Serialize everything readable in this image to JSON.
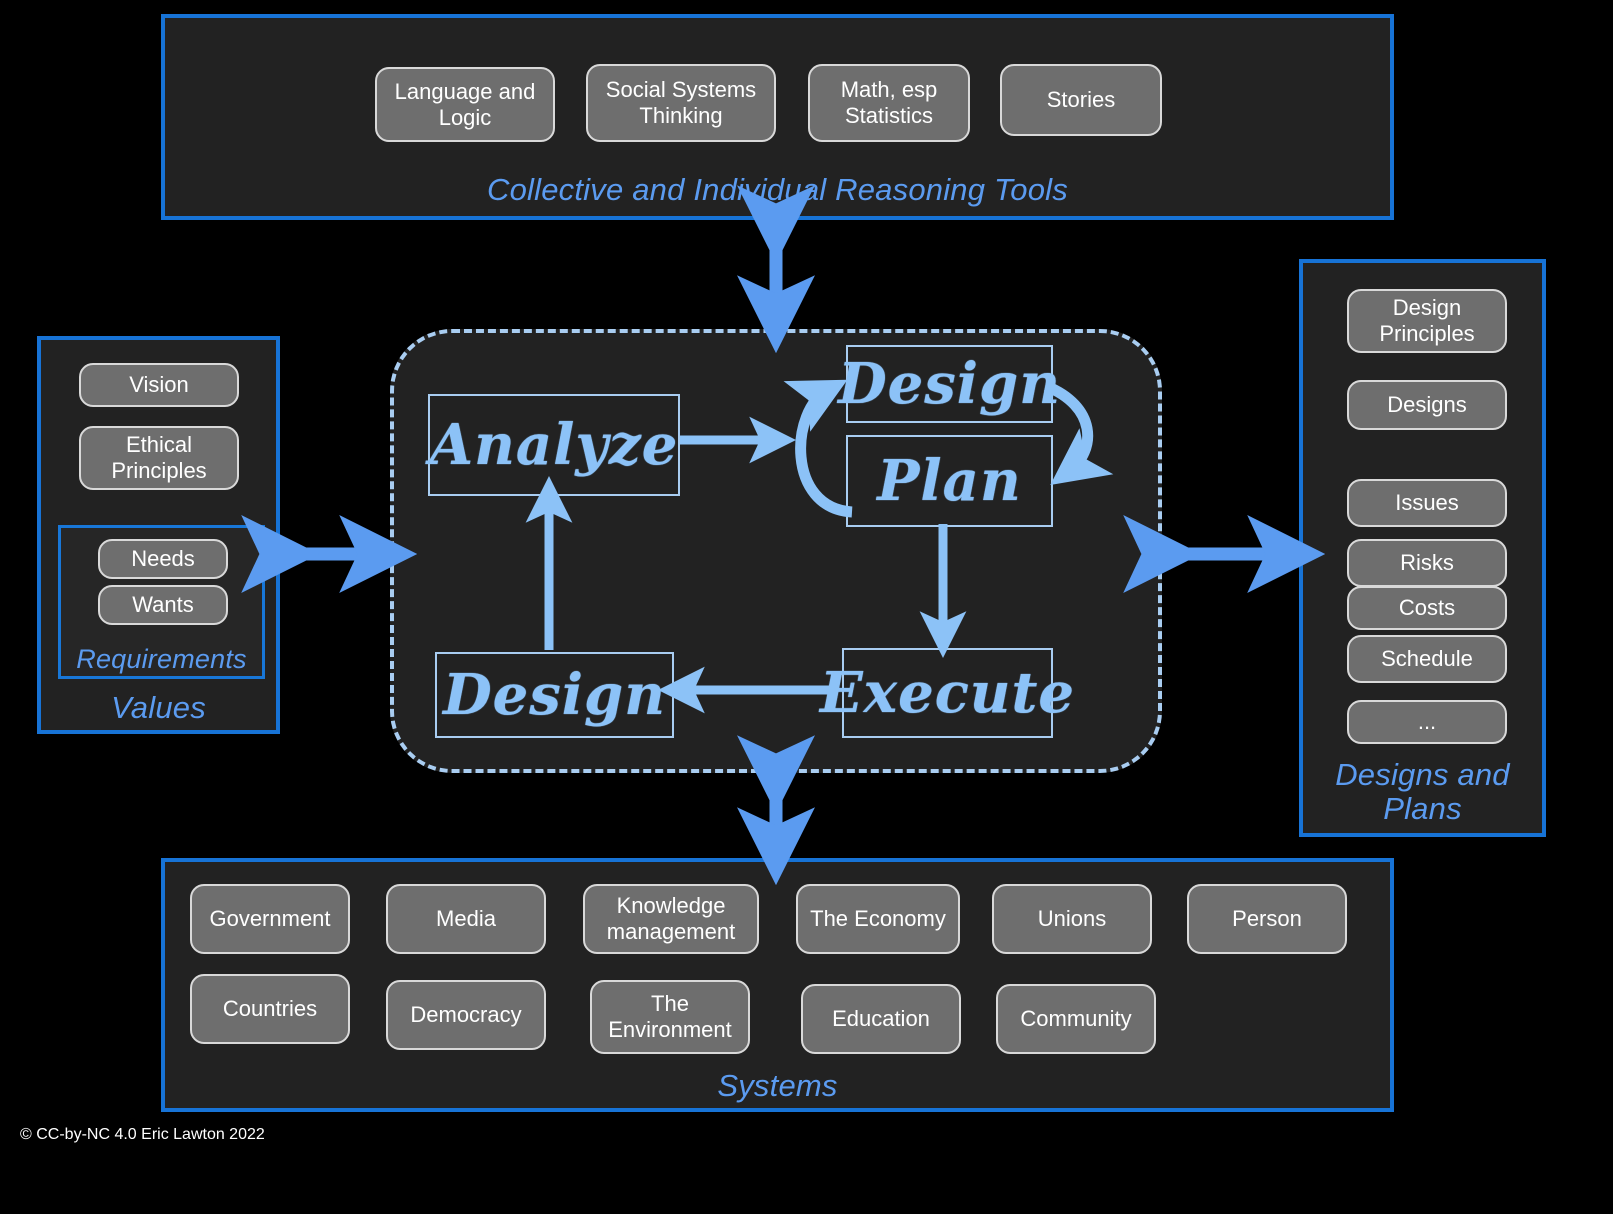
{
  "colors": {
    "background": "#000000",
    "panel_fill": "#222222",
    "panel_border_blue": "#1773d6",
    "label_blue": "#5b9bf0",
    "arrow_blue": "#5b9bf0",
    "cycle_blue": "#8cc2f7",
    "dashed_border": "#a9cdf1",
    "pill_fill": "#6e6e6e",
    "pill_border": "#d9d9d9",
    "pill_text": "#ffffff"
  },
  "top_panel": {
    "label": "Collective and Individual Reasoning Tools",
    "items": [
      {
        "label": "Language and Logic"
      },
      {
        "label": "Social Systems Thinking"
      },
      {
        "label": "Math, esp Statistics"
      },
      {
        "label": "Stories"
      }
    ]
  },
  "left_panel": {
    "label": "Values",
    "items": [
      {
        "label": "Vision"
      },
      {
        "label": "Ethical Principles"
      }
    ],
    "requirements": {
      "label": "Requirements",
      "items": [
        {
          "label": "Needs"
        },
        {
          "label": "Wants"
        }
      ]
    }
  },
  "right_panel": {
    "label": "Designs and Plans",
    "items": [
      {
        "label": "Design Principles"
      },
      {
        "label": "Designs"
      },
      {
        "label": "Issues"
      },
      {
        "label": "Risks"
      },
      {
        "label": "Costs"
      },
      {
        "label": "Schedule"
      },
      {
        "label": "..."
      }
    ]
  },
  "bottom_panel": {
    "label": "Systems",
    "items": [
      {
        "label": "Government"
      },
      {
        "label": "Media"
      },
      {
        "label": "Knowledge management"
      },
      {
        "label": "The Economy"
      },
      {
        "label": "Unions"
      },
      {
        "label": "Person"
      },
      {
        "label": "Countries"
      },
      {
        "label": "Democracy"
      },
      {
        "label": "The Environment"
      },
      {
        "label": "Education"
      },
      {
        "label": "Community"
      }
    ]
  },
  "cycle": {
    "nodes": [
      {
        "label": "Analyze"
      },
      {
        "label": "Design"
      },
      {
        "label": "Plan"
      },
      {
        "label": "Execute"
      },
      {
        "label": "Design"
      }
    ],
    "connections": [
      {
        "from": "Analyze",
        "to": "Design",
        "kind": "single"
      },
      {
        "from": "Design",
        "to": "Plan",
        "kind": "loop"
      },
      {
        "from": "Plan",
        "to": "Execute",
        "kind": "single"
      },
      {
        "from": "Execute",
        "to": "Design",
        "kind": "single"
      },
      {
        "from": "Design",
        "to": "Analyze",
        "kind": "single"
      }
    ]
  },
  "connectors": [
    {
      "name": "top-connector",
      "kind": "double-vertical"
    },
    {
      "name": "bottom-connector",
      "kind": "double-vertical"
    },
    {
      "name": "left-connector",
      "kind": "double-horizontal"
    },
    {
      "name": "right-connector",
      "kind": "double-horizontal"
    }
  ],
  "copyright": "© CC-by-NC 4.0 Eric Lawton 2022"
}
